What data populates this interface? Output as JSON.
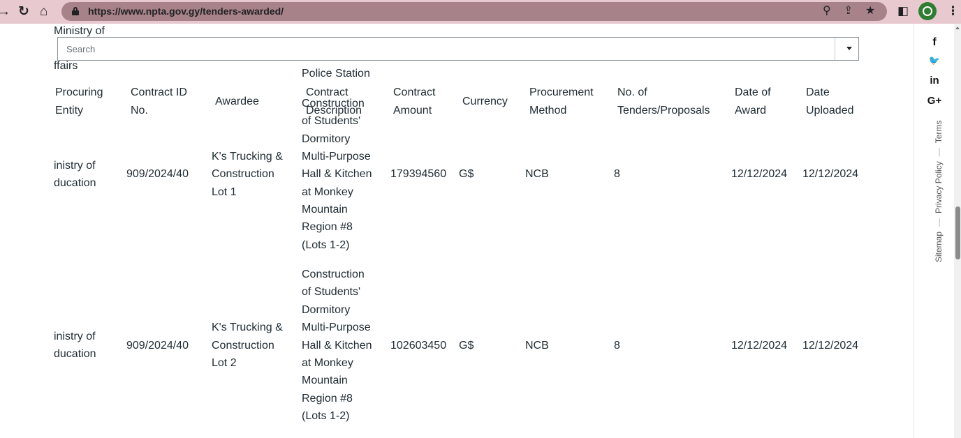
{
  "browser": {
    "url": "https://www.npta.gov.gy/tenders-awarded/",
    "icons": [
      "back-arrow-icon",
      "reload-icon",
      "home-icon",
      "lock-icon",
      "zoom-icon",
      "share-icon",
      "bookmark-star-icon",
      "sidebar-icon",
      "profile-icon",
      "menu-icon"
    ]
  },
  "page": {
    "search": {
      "placeholder": "Search"
    },
    "partial_row": {
      "entity_line1": "Ministry of",
      "entity_line3": "ffairs",
      "description_last": "Police Station"
    },
    "table": {
      "headers": {
        "procuring_entity": [
          "Procuring",
          "Entity"
        ],
        "contract_id": [
          "Contract ID",
          "No."
        ],
        "awardee": "Awardee",
        "contract_description": [
          "Contract",
          "Description"
        ],
        "contract_amount": [
          "Contract",
          "Amount"
        ],
        "currency": "Currency",
        "procurement_method": [
          "Procurement",
          "Method"
        ],
        "tenders": [
          "No. of",
          "Tenders/Proposals"
        ],
        "date_of_award": [
          "Date of",
          "Award"
        ],
        "date_uploaded": [
          "Date",
          "Uploaded"
        ]
      },
      "rows": [
        {
          "entity": [
            "inistry of",
            "ducation"
          ],
          "contract_id": "909/2024/40",
          "awardee": [
            "K's Trucking &",
            "Construction",
            "Lot 1"
          ],
          "description": [
            "Construction",
            "of Students'",
            "Dormitory",
            "Multi-Purpose",
            "Hall & Kitchen",
            "at Monkey",
            "Mountain",
            "Region #8",
            "(Lots 1-2)"
          ],
          "amount": "179394560",
          "currency": "G$",
          "method": "NCB",
          "tenders": "8",
          "date_award": "12/12/2024",
          "date_uploaded": "12/12/2024"
        },
        {
          "entity": [
            "inistry of",
            "ducation"
          ],
          "contract_id": "909/2024/40",
          "awardee": [
            "K's Trucking &",
            "Construction",
            "Lot 2"
          ],
          "description": [
            "Construction",
            "of Students'",
            "Dormitory",
            "Multi-Purpose",
            "Hall & Kitchen",
            "at Monkey",
            "Mountain",
            "Region #8",
            "(Lots 1-2)"
          ],
          "amount": "102603450",
          "currency": "G$",
          "method": "NCB",
          "tenders": "8",
          "date_award": "12/12/2024",
          "date_uploaded": "12/12/2024"
        }
      ]
    }
  },
  "sidebar": {
    "social": [
      {
        "label": "f",
        "icon": "facebook-icon"
      },
      {
        "label": "🐦",
        "icon": "twitter-icon"
      },
      {
        "label": "in",
        "icon": "linkedin-icon"
      },
      {
        "label": "G+",
        "icon": "google-plus-icon"
      }
    ],
    "links": [
      "Sitemap",
      "Privacy Policy",
      "Terms"
    ]
  }
}
